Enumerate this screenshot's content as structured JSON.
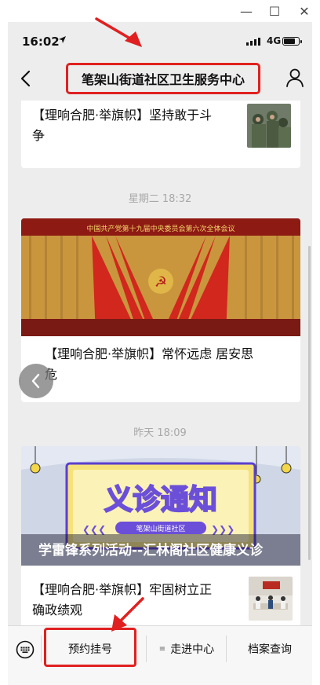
{
  "window": {
    "minimize_glyph": "—",
    "maximize_glyph": "☐",
    "close_glyph": "✕"
  },
  "status_bar": {
    "time": "16:02",
    "network": "4G"
  },
  "nav": {
    "title": "笔架山街道社区卫生服务中心"
  },
  "feed": {
    "items": [
      {
        "text": "【理响合肥·举旗帜】坚持敢于斗争",
        "text_line1": "【理响合肥·举旗帜】坚持敢于斗",
        "text_line2": "争"
      },
      {
        "timestamp": "星期二 18:32",
        "banner_text": "中国共产党第十九届中央委员会第六次全体会议",
        "text_line1": "【理响合肥·举旗帜】常怀远虑 居安思",
        "text_line2": "危"
      },
      {
        "timestamp": "昨天 18:09",
        "poster_title": "义诊通知",
        "poster_badge": "笔架山街道社区",
        "overlay_caption": "学雷锋系列活动--汇林阁社区健康义诊",
        "text_line1": "【理响合肥·举旗帜】牢固树立正",
        "text_line2": "确政绩观"
      }
    ]
  },
  "bottom_menu": {
    "items": [
      {
        "label": "预约挂号"
      },
      {
        "label": "走进中心",
        "prefix": "≡"
      },
      {
        "label": "档案查询"
      }
    ]
  },
  "colors": {
    "highlight_red": "#e02020",
    "chat_bg": "#ededed",
    "poster_yellow": "#f4d94a",
    "poster_purple": "#6b4fd8"
  },
  "icons": [
    "back-icon",
    "person-icon",
    "location-arrow-icon",
    "signal-icon",
    "battery-icon",
    "keyboard-icon",
    "chevron-left-icon"
  ]
}
